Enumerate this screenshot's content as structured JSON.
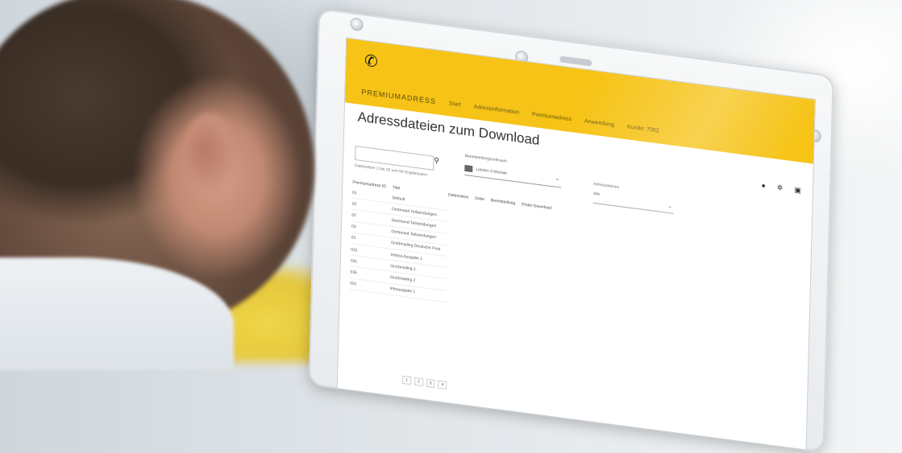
{
  "header": {
    "logo_icon": "post-horn-icon",
    "brand": "PREMIUMADRESS",
    "nav_items": [
      "Start",
      "Adressinformation",
      "Premiumadress",
      "Anwendung",
      "Kunde: 7002"
    ]
  },
  "page": {
    "title": "Adressdateien zum Download",
    "hits_text": "Datensätze 1 bis 10 von 50 Ergebnissen",
    "search_placeholder": ""
  },
  "filters": {
    "period_label": "Bereitstellungszeitraum",
    "period_value": "Letzten 3 Monate",
    "type_label": "Adressdateien",
    "type_value": "Alle"
  },
  "table": {
    "columns": [
      "Premiumadress ID",
      "Titel",
      "Datensätze",
      "Datei",
      "Bereitstellung",
      "Erster Download"
    ],
    "rows": [
      [
        "01",
        "Default",
        "",
        "",
        "",
        ""
      ],
      [
        "02",
        "Dortmund Teilsendungen",
        "",
        "",
        "",
        ""
      ],
      [
        "02",
        "Dortmund Teilsendungen",
        "",
        "",
        "",
        ""
      ],
      [
        "03",
        "Dortmund Teilsendungen",
        "",
        "",
        "",
        ""
      ],
      [
        "03",
        "Großmailing Deutsche Post",
        "",
        "",
        "",
        ""
      ],
      [
        "031",
        "Imbiss Ausgabe 1",
        "",
        "",
        "",
        ""
      ],
      [
        "031",
        "Großmailing 1",
        "",
        "",
        "",
        ""
      ],
      [
        "035",
        "Großmailing 2",
        "",
        "",
        "",
        ""
      ],
      [
        "031",
        "Infoausgabe 1",
        "",
        "",
        "",
        ""
      ]
    ]
  },
  "pagination": [
    "1",
    "2",
    "3",
    "4"
  ],
  "colors": {
    "brand_yellow": "#f6c316"
  }
}
